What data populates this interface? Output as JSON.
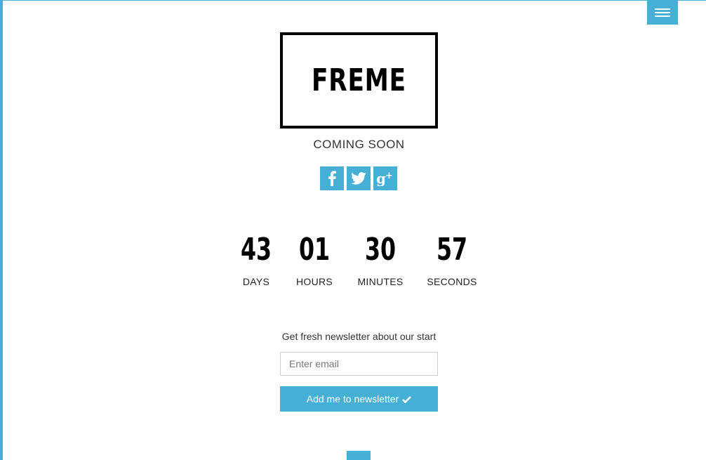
{
  "header": {
    "menu_icon": "hamburger-icon"
  },
  "logo": {
    "text": "FREME"
  },
  "tagline": "COMING SOON",
  "social": [
    {
      "name": "facebook",
      "icon": "facebook-icon"
    },
    {
      "name": "twitter",
      "icon": "twitter-icon"
    },
    {
      "name": "google-plus",
      "icon": "google-plus-icon"
    }
  ],
  "countdown": {
    "days": {
      "value": "43",
      "label": "DAYS"
    },
    "hours": {
      "value": "01",
      "label": "HOURS"
    },
    "minutes": {
      "value": "30",
      "label": "MINUTES"
    },
    "seconds": {
      "value": "57",
      "label": "SECONDS"
    }
  },
  "newsletter": {
    "text": "Get fresh newsletter about our start",
    "placeholder": "Enter email",
    "button_label": "Add me to newsletter",
    "button_icon": "checkmark-icon"
  },
  "colors": {
    "accent": "#45afd6",
    "text": "#000000",
    "background": "#ffffff"
  }
}
